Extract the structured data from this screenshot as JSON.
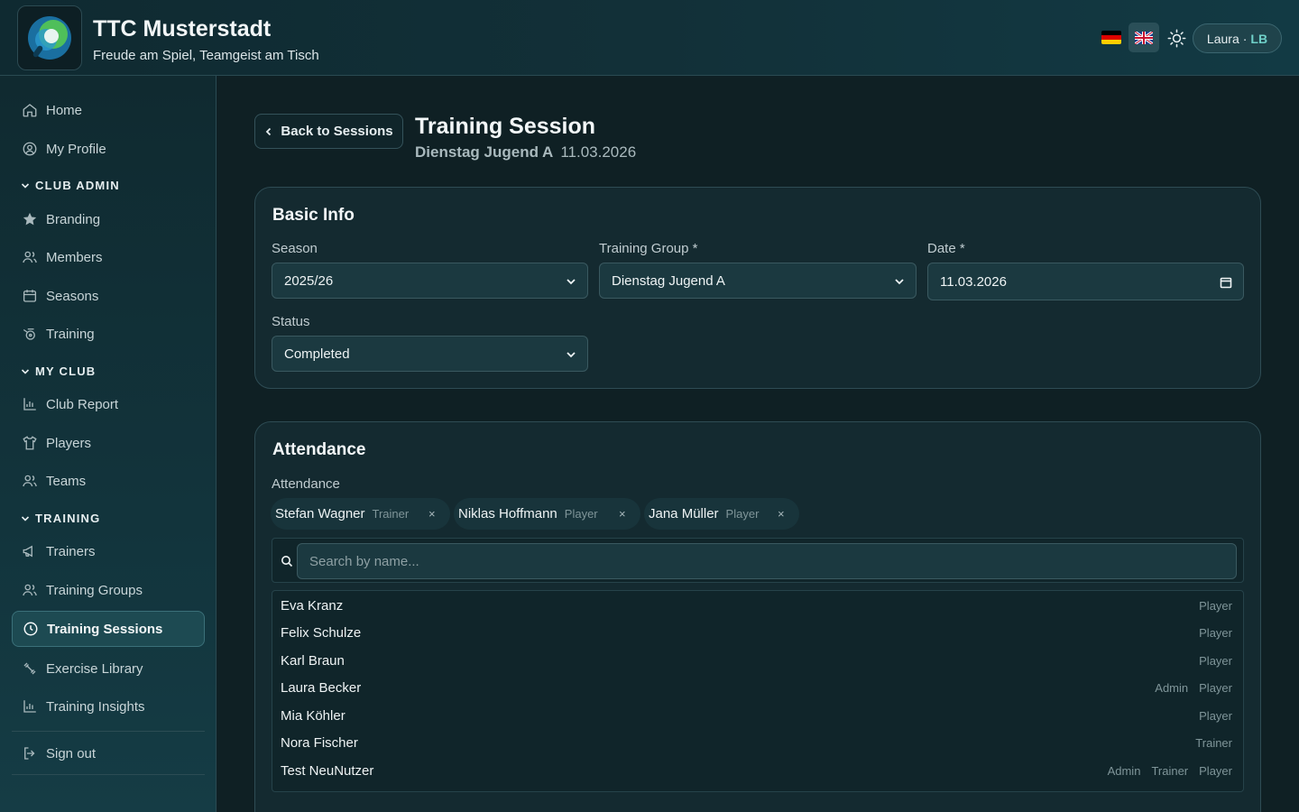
{
  "header": {
    "club_name": "TTC Musterstadt",
    "tagline": "Freude am Spiel, Teamgeist am Tisch",
    "user_name": "Laura",
    "user_separator": "·",
    "user_initials": "LB"
  },
  "sidebar": {
    "home": "Home",
    "my_profile": "My Profile",
    "section_club_admin": "CLUB ADMIN",
    "branding": "Branding",
    "members": "Members",
    "seasons": "Seasons",
    "training": "Training",
    "section_my_club": "MY CLUB",
    "club_report": "Club Report",
    "players": "Players",
    "teams": "Teams",
    "section_training": "TRAINING",
    "trainers": "Trainers",
    "training_groups": "Training Groups",
    "training_sessions": "Training Sessions",
    "exercise_library": "Exercise Library",
    "training_insights": "Training Insights",
    "sign_out": "Sign out"
  },
  "page": {
    "back_label": "Back to Sessions",
    "title": "Training Session",
    "subtitle_group": "Dienstag Jugend A",
    "subtitle_date": "11.03.2026"
  },
  "basic_info": {
    "title": "Basic Info",
    "season_label": "Season",
    "season_value": "2025/26",
    "group_label": "Training Group *",
    "group_value": "Dienstag Jugend A",
    "date_label": "Date *",
    "date_value": "11.03.2026",
    "status_label": "Status",
    "status_value": "Completed"
  },
  "attendance": {
    "title": "Attendance",
    "label": "Attendance",
    "chips": [
      {
        "name": "Stefan Wagner",
        "role": "Trainer"
      },
      {
        "name": "Niklas Hoffmann",
        "role": "Player"
      },
      {
        "name": "Jana Müller",
        "role": "Player"
      }
    ],
    "remove_glyph": "×",
    "search_placeholder": "Search by name...",
    "list": [
      {
        "name": "Eva Kranz",
        "tags": [
          "Player"
        ]
      },
      {
        "name": "Felix Schulze",
        "tags": [
          "Player"
        ]
      },
      {
        "name": "Karl Braun",
        "tags": [
          "Player"
        ]
      },
      {
        "name": "Laura Becker",
        "tags": [
          "Admin",
          "Player"
        ]
      },
      {
        "name": "Mia Köhler",
        "tags": [
          "Player"
        ]
      },
      {
        "name": "Nora Fischer",
        "tags": [
          "Trainer"
        ]
      },
      {
        "name": "Test NeuNutzer",
        "tags": [
          "Admin",
          "Trainer",
          "Player"
        ]
      }
    ]
  },
  "colors": {
    "accent": "#6fd0c8",
    "background": "#0f2126",
    "card": "#142a30",
    "active_nav": "#1d4a52"
  }
}
